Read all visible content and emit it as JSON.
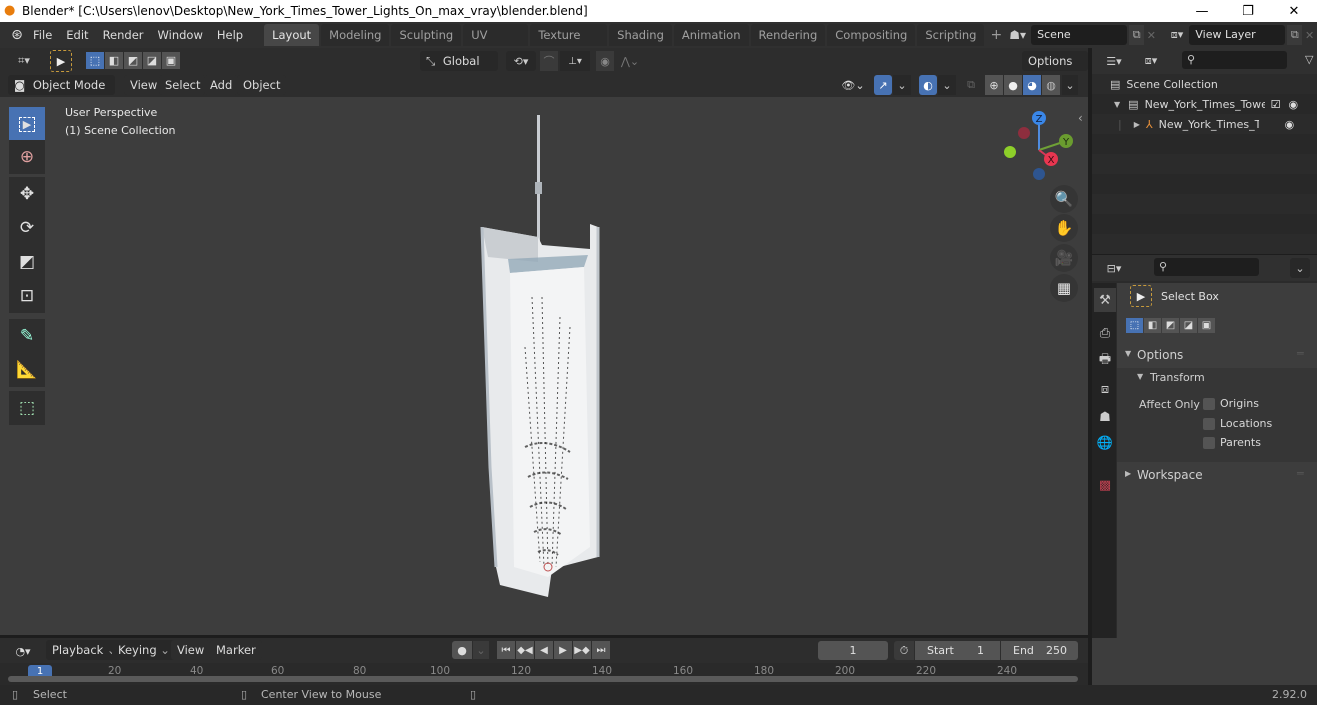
{
  "window": {
    "title": "Blender* [C:\\Users\\lenov\\Desktop\\New_York_Times_Tower_Lights_On_max_vray\\blender.blend]",
    "controls": {
      "minimize": "—",
      "maximize": "❐",
      "close": "✕"
    }
  },
  "menu": {
    "items": [
      "File",
      "Edit",
      "Render",
      "Window",
      "Help"
    ]
  },
  "workspaces": {
    "tabs": [
      "Layout",
      "Modeling",
      "Sculpting",
      "UV Editing",
      "Texture Paint",
      "Shading",
      "Animation",
      "Rendering",
      "Compositing",
      "Scripting"
    ],
    "active": "Layout",
    "add_label": "+"
  },
  "scene": {
    "name": "Scene"
  },
  "view_layer": {
    "name": "View Layer"
  },
  "tool_header": {
    "transform_orientation": "Global",
    "options_label": "Options"
  },
  "view_header": {
    "mode": "Object Mode",
    "menus": [
      "View",
      "Select",
      "Add",
      "Object"
    ]
  },
  "viewport": {
    "perspective_label": "User Perspective",
    "collection_label": "(1) Scene Collection",
    "gizmo": {
      "x": "X",
      "y": "Y",
      "z": "Z"
    },
    "tools": [
      "select-box",
      "cursor",
      "move",
      "rotate",
      "scale",
      "transform",
      "annotate",
      "measure",
      "add-cube"
    ],
    "active_tool": "select-box"
  },
  "outliner": {
    "root": "Scene Collection",
    "items": [
      {
        "label": "New_York_Times_Tower_",
        "type": "collection",
        "checked": true,
        "visible": true
      },
      {
        "label": "New_York_Times_To",
        "type": "object",
        "visible": true
      }
    ]
  },
  "properties": {
    "tool_name": "Select Box",
    "sections": {
      "options": "Options",
      "transform": "Transform",
      "affect_only": "Affect Only",
      "checkboxes": [
        "Origins",
        "Locations",
        "Parents"
      ],
      "workspace": "Workspace"
    }
  },
  "timeline": {
    "menus": [
      "Playback",
      "Keying",
      "View",
      "Marker"
    ],
    "current_frame": "1",
    "start_label": "Start",
    "start": "1",
    "end_label": "End",
    "end": "250",
    "ticks": [
      "20",
      "40",
      "60",
      "80",
      "100",
      "120",
      "140",
      "160",
      "180",
      "200",
      "220",
      "240"
    ],
    "frame_marker": "1"
  },
  "statusbar": {
    "left_action": "Select",
    "middle_action": "Center View to Mouse",
    "version": "2.92.0"
  }
}
